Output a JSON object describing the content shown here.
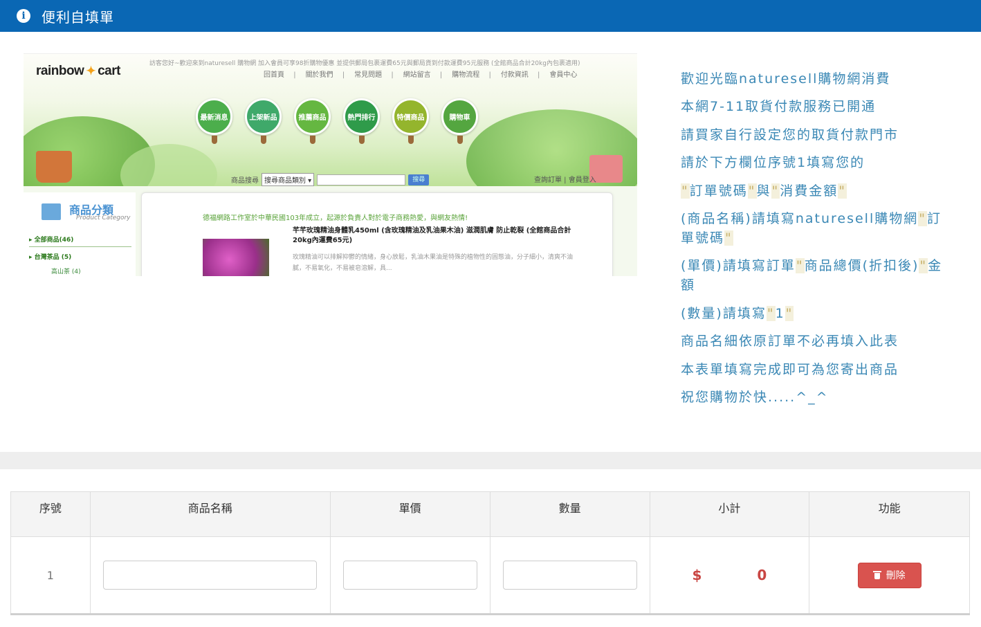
{
  "header": {
    "title": "便利自填單",
    "icon": "info-icon",
    "color": "#0a67b4"
  },
  "screenshot": {
    "logo_left": "rainbow",
    "logo_right": "cart",
    "logo_sub": "",
    "promo": "訪客您好~歡迎來到naturesell 購物網 加入會員可享98折購物優惠 並提供郵局包裹運費65元與郵局貨到付款運費95元服務 (全館商品合計20kg內包裹適用)",
    "topnav": [
      "回首頁",
      "關於我們",
      "常見問題",
      "網站留言",
      "購物流程",
      "付款資訊",
      "會員中心"
    ],
    "circles": [
      "最新消息",
      "上架新品",
      "推薦商品",
      "熱門排行",
      "特價商品",
      "購物車"
    ],
    "search_label": "商品搜尋",
    "search_select": "搜尋商品類別 ▾",
    "search_button": "搜尋",
    "member_links": "查詢訂單 | 會員登入",
    "category_title": "商品分類",
    "category_sub": "Product Category",
    "category_items": [
      "全部商品(46)",
      "台灣茶品 (5)"
    ],
    "category_subitem": "高山茶 (4)",
    "intro": "德福網路工作室於中華民國103年成立，起源於負責人對於電子商務熱愛，與網友熱情!",
    "product_title": "芊芊玫瑰精油身體乳450ml (含玫瑰精油及乳油果木油) 滋潤肌膚 防止乾裂 (全館商品合計20kg內運費65元)",
    "product_desc": "玫瑰精油可以排解抑鬱的情緒，身心放鬆，乳油木果油是特殊的植物性的固態油，分子細小，清爽不油膩，不易氧化，不易被皂溶解，具..."
  },
  "instructions": {
    "line1": "歡迎光臨naturesell購物網消費",
    "line2": "本網7-11取貨付款服務已開通",
    "line3": "請買家自行設定您的取貨付款門市",
    "line4": "請於下方欄位序號1填寫您的",
    "q": "\"",
    "order_no": "訂單號碼",
    "and": "與",
    "amount": "消費金額",
    "name_prefix": "(商品名稱)請填寫naturesell購物網",
    "price_prefix": "(單價)請填寫訂單",
    "price_total": "商品總價(折扣後)",
    "price_suffix": "金額",
    "qty_prefix": "(數量)請填寫",
    "qty_value": "1",
    "line9": "商品名細依原訂單不必再填入此表",
    "line10": "本表單填寫完成即可為您寄出商品",
    "line11": "祝您購物於快.....^_^",
    "text_color": "#3b88b5"
  },
  "table": {
    "headers": [
      "序號",
      "商品名稱",
      "單價",
      "數量",
      "小計",
      "功能"
    ],
    "rows": [
      {
        "index": "1",
        "name_value": "",
        "price_value": "",
        "qty_value": "",
        "currency": "$",
        "subtotal": "0",
        "delete_label": "刪除"
      }
    ],
    "delete_color": "#d9534f"
  }
}
